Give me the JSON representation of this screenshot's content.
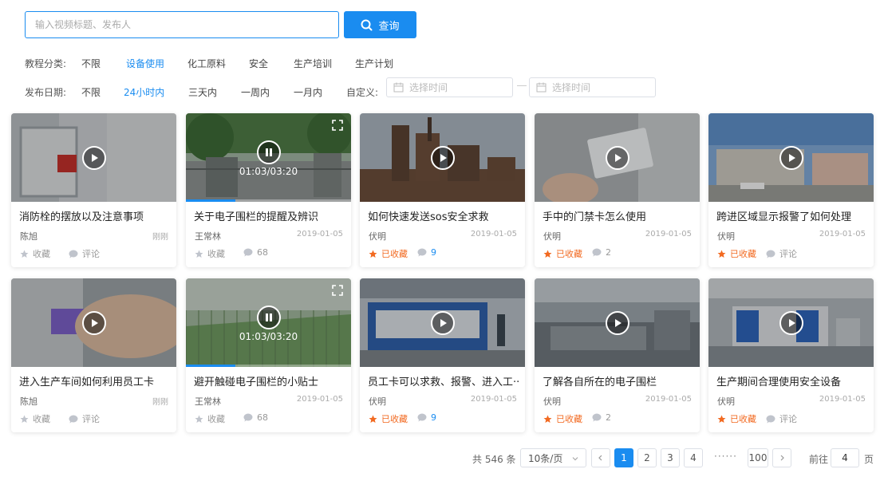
{
  "search": {
    "placeholder": "输入视频标题、发布人",
    "button_label": "查询"
  },
  "filters": {
    "category_label": "教程分类:",
    "categories": [
      "不限",
      "设备使用",
      "化工原料",
      "安全",
      "生产培训",
      "生产计划"
    ],
    "category_active": "设备使用",
    "date_label": "发布日期:",
    "dates": [
      "不限",
      "24小时内",
      "三天内",
      "一周内",
      "一月内"
    ],
    "date_active": "24小时内",
    "custom_label": "自定义:",
    "date_start_placeholder": "选择时间",
    "date_end_placeholder": "选择时间"
  },
  "cards": [
    {
      "title": "消防栓的摆放以及注意事项",
      "author": "陈旭",
      "date": "刚刚",
      "fav": "收藏",
      "favorited": false,
      "comment": "评论",
      "comment_style": "gray",
      "thumb": "hydrant",
      "playing": false
    },
    {
      "title": "关于电子围栏的提醒及辨识",
      "author": "王常林",
      "date": "2019-01-05",
      "fav": "收藏",
      "favorited": false,
      "comment": "68",
      "comment_style": "gray",
      "thumb": "gate",
      "playing": true,
      "time": "01:03/03:20",
      "progress": 0.3
    },
    {
      "title": "如何快速发送sos安全求救",
      "author": "伏明",
      "date": "2019-01-05",
      "fav": "已收藏",
      "favorited": true,
      "comment": "9",
      "comment_style": "blue",
      "thumb": "steel",
      "playing": false
    },
    {
      "title": "手中的门禁卡怎么使用",
      "author": "伏明",
      "date": "2019-01-05",
      "fav": "已收藏",
      "favorited": true,
      "comment": "2",
      "comment_style": "gray",
      "thumb": "card",
      "playing": false
    },
    {
      "title": "跨进区域显示报警了如何处理",
      "author": "伏明",
      "date": "2019-01-05",
      "fav": "已收藏",
      "favorited": true,
      "comment": "评论",
      "comment_style": "gray",
      "thumb": "building",
      "playing": false
    },
    {
      "title": "进入生产车间如何利用员工卡",
      "author": "陈旭",
      "date": "刚刚",
      "fav": "收藏",
      "favorited": false,
      "comment": "评论",
      "comment_style": "gray",
      "thumb": "handcard",
      "playing": false
    },
    {
      "title": "避开触碰电子围栏的小贴士",
      "author": "王常林",
      "date": "2019-01-05",
      "fav": "收藏",
      "favorited": false,
      "comment": "68",
      "comment_style": "gray",
      "thumb": "fence",
      "playing": true,
      "time": "01:03/03:20",
      "progress": 0.3
    },
    {
      "title": "员工卡可以求救、报警、进入工··",
      "author": "伏明",
      "date": "2019-01-05",
      "fav": "已收藏",
      "favorited": true,
      "comment": "9",
      "comment_style": "blue",
      "thumb": "machine",
      "playing": false
    },
    {
      "title": "了解各自所在的电子围栏",
      "author": "伏明",
      "date": "2019-01-05",
      "fav": "已收藏",
      "favorited": true,
      "comment": "2",
      "comment_style": "gray",
      "thumb": "workshop",
      "playing": false
    },
    {
      "title": "生产期间合理使用安全设备",
      "author": "伏明",
      "date": "2019-01-05",
      "fav": "已收藏",
      "favorited": true,
      "comment": "评论",
      "comment_style": "gray",
      "thumb": "factory",
      "playing": false
    }
  ],
  "pagination": {
    "total": "共 546 条",
    "page_size": "10条/页",
    "prev_icon": "chevron-left-icon",
    "next_icon": "chevron-right-icon",
    "pages": [
      "1",
      "2",
      "3",
      "4"
    ],
    "current": "1",
    "ellipsis": "······",
    "last": "100",
    "goto_label": "前往",
    "goto_value": "4",
    "goto_unit": "页"
  },
  "colors": {
    "accent": "#1a8cf0",
    "favorite": "#f26a21",
    "muted": "#999999"
  }
}
